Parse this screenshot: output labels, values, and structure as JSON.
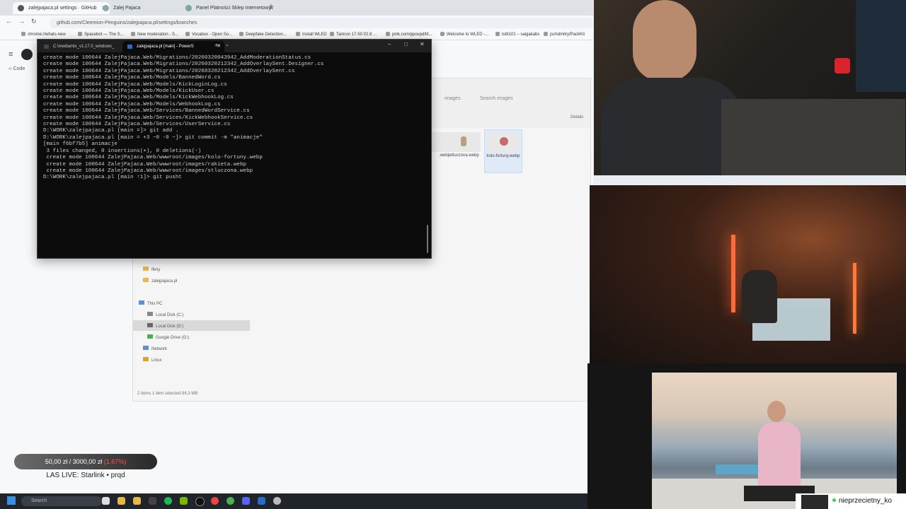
{
  "browser": {
    "tabs": [
      {
        "label": "zalejpajaca.pl settings · GitHub",
        "active": true
      },
      {
        "label": "Zalej Pajaca",
        "active": false
      },
      {
        "label": "Panel Platności Sklep Internetowy",
        "active": false
      }
    ],
    "url": "github.com/Cleemion-Penguins/zalejpajaca.pl/settings/branches",
    "bookmarks": [
      "chrome://whats-new",
      "Spacebot — The S...",
      "New moderation - S...",
      "Vocabox - Open So...",
      "Deepfake Detection...",
      "Install WLED",
      "Tamron 17-50 f/2.8 ...",
      "pink.com/ppovpd/lit...",
      "Welcome to WLED -...",
      "tutti101 – saigakabs",
      "jschdmitry/PackKit"
    ],
    "gh_code_tab": "Code"
  },
  "explorer": {
    "breadcrumb": "images",
    "search_placeholder": "Search images",
    "details_label": "Details",
    "thumbnails": [
      {
        "name": ".webp",
        "selected": false
      },
      {
        "name": "stluczona.webp",
        "selected": false
      },
      {
        "name": "kolo-fortuny.webp",
        "selected": true
      }
    ],
    "nav": [
      {
        "label": "filmy"
      },
      {
        "label": "zalejpajaca.pl"
      },
      {
        "label": "This PC"
      },
      {
        "label": "Local Disk (C:)"
      },
      {
        "label": "Local Disk (D:)"
      },
      {
        "label": "Google Drive (G:)"
      },
      {
        "label": "Network"
      },
      {
        "label": "Linux"
      }
    ],
    "status": "2 items     1 item selected  94,3 MB"
  },
  "terminal": {
    "tabs": [
      {
        "label": "C:\\mediamtx_v1.17.0_windows_",
        "active": false
      },
      {
        "label": "zalejpajaca.pl [main] - PowerS",
        "active": true
      }
    ],
    "lines": [
      "create mode 100644 ZalejPajaca.Web/Migrations/20260320043942_AddModerationStatus.cs",
      "create mode 100644 ZalejPajaca.Web/Migrations/20260320212342_AddOverlaySent.Designer.cs",
      "create mode 100644 ZalejPajaca.Web/Migrations/20260320212342_AddOverlaySent.cs",
      "create mode 100644 ZalejPajaca.Web/Models/BannedWord.cs",
      "create mode 100644 ZalejPajaca.Web/Models/KickLoginLog.cs",
      "create mode 100644 ZalejPajaca.Web/Models/KickUser.cs",
      "create mode 100644 ZalejPajaca.Web/Models/KickWebhookLog.cs",
      "create mode 100644 ZalejPajaca.Web/Models/WebhookLog.cs",
      "create mode 100644 ZalejPajaca.Web/Services/BannedWordService.cs",
      "create mode 100644 ZalejPajaca.Web/Services/KickWebhookService.cs",
      "create mode 100644 ZalejPajaca.Web/Services/UserService.cs",
      "D:\\WORK\\zalejpajaca.pl [main =]> git add .",
      "D:\\WORK\\zalejpajaca.pl [main = +3 ~0 -0 ~]> git commit -m \"animacje\"",
      "[main f6bf7b5] animacje",
      " 3 files changed, 0 insertions(+), 0 deletions(-)",
      " create mode 100644 ZalejPajaca.Web/wwwroot/images/kolo-fortuny.webp",
      " create mode 100644 ZalejPajaca.Web/wwwroot/images/rakieta.webp",
      " create mode 100644 ZalejPajaca.Web/wwwroot/images/stluczona.webp",
      "D:\\WORK\\zalejpajaca.pl [main ↑1]> git pusht"
    ]
  },
  "overlay": {
    "donation": {
      "current": "50,00 zł",
      "goal": "3000,00 zł",
      "percent": "(1.67%)",
      "progress": 0.0167
    },
    "last_live": "LAS LIVE: Starlink • prqd"
  },
  "taskbar": {
    "search_placeholder": "Search",
    "icons": [
      "windows-start-icon",
      "explorer-icon",
      "folder-icon",
      "terminal-icon",
      "spotify-icon",
      "nvidia-icon",
      "obs-icon",
      "chrome-icon",
      "discord-icon",
      "editor-icon",
      "media-icon"
    ]
  },
  "stream": {
    "username": "nieprzecietny_ko"
  }
}
